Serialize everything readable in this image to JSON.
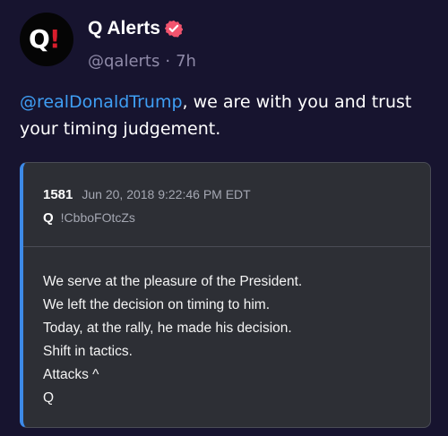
{
  "tweet": {
    "display_name": "Q Alerts",
    "handle": "@qalerts",
    "separator": "·",
    "time_ago": "7h",
    "avatar": {
      "letter": "Q",
      "mark": "!",
      "accent_color": "#d91d2c"
    },
    "badge": {
      "icon": "verified-check-icon",
      "color": "#f2546e"
    },
    "text": {
      "mention": "@realDonaldTrump",
      "rest": ", we are with you and trust your timing judgement."
    }
  },
  "quoted_post": {
    "number": "1581",
    "date": "Jun 20, 2018 9:22:46 PM EDT",
    "poster": "Q",
    "tripcode": "!CbboFOtcZs",
    "accent_color": "#3d8ae8",
    "lines": [
      "We serve at the pleasure of the President.",
      "We left the decision on timing to him.",
      "Today, at the rally, he made his decision.",
      "Shift in tactics.",
      "Attacks ^",
      "Q"
    ]
  }
}
